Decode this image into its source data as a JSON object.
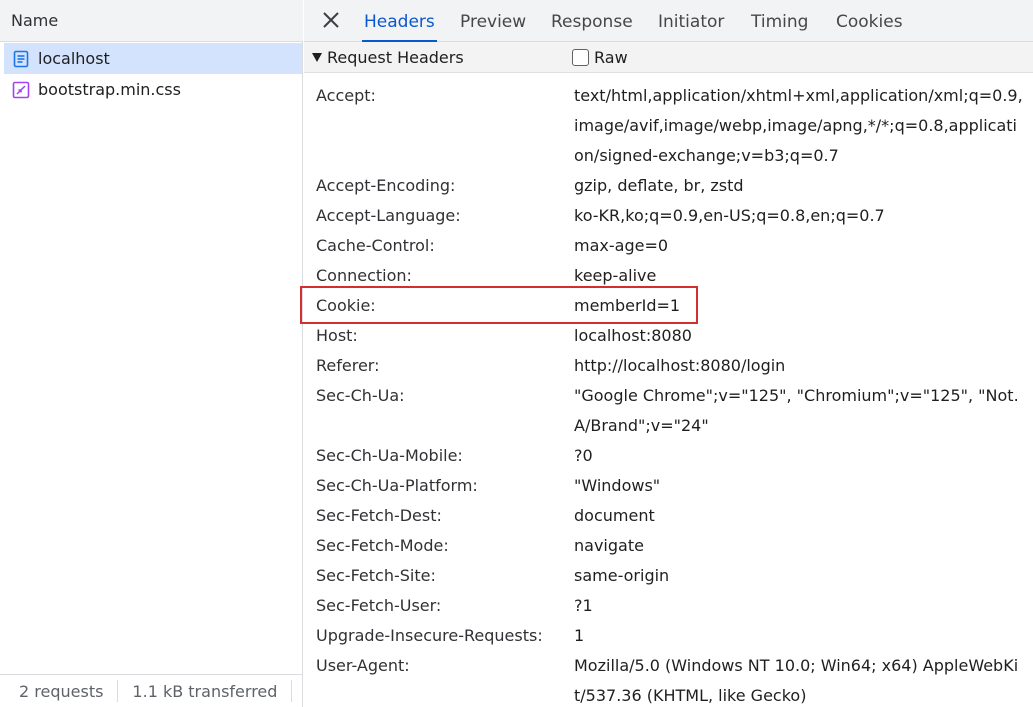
{
  "request_list": {
    "header": "Name",
    "items": [
      {
        "label": "localhost",
        "icon": "document-icon",
        "selected": true
      },
      {
        "label": "bootstrap.min.css",
        "icon": "stylesheet-icon",
        "selected": false
      }
    ],
    "status": {
      "requests": "2 requests",
      "transferred": "1.1 kB transferred"
    }
  },
  "tabs": [
    "Headers",
    "Preview",
    "Response",
    "Initiator",
    "Timing",
    "Cookies"
  ],
  "active_tab": "Headers",
  "section": {
    "title": "Request Headers",
    "raw_label": "Raw",
    "raw_checked": false
  },
  "headers": [
    {
      "name": "Accept:",
      "value": "text/html,application/xhtml+xml,application/xml;q=0.9,image/avif,image/webp,image/apng,*/*;q=0.8,application/signed-exchange;v=b3;q=0.7"
    },
    {
      "name": "Accept-Encoding:",
      "value": "gzip, deflate, br, zstd"
    },
    {
      "name": "Accept-Language:",
      "value": "ko-KR,ko;q=0.9,en-US;q=0.8,en;q=0.7"
    },
    {
      "name": "Cache-Control:",
      "value": "max-age=0"
    },
    {
      "name": "Connection:",
      "value": "keep-alive"
    },
    {
      "name": "Cookie:",
      "value": "memberId=1"
    },
    {
      "name": "Host:",
      "value": "localhost:8080"
    },
    {
      "name": "Referer:",
      "value": "http://localhost:8080/login"
    },
    {
      "name": "Sec-Ch-Ua:",
      "value": "\"Google Chrome\";v=\"125\", \"Chromium\";v=\"125\", \"Not.A/Brand\";v=\"24\""
    },
    {
      "name": "Sec-Ch-Ua-Mobile:",
      "value": "?0"
    },
    {
      "name": "Sec-Ch-Ua-Platform:",
      "value": "\"Windows\""
    },
    {
      "name": "Sec-Fetch-Dest:",
      "value": "document"
    },
    {
      "name": "Sec-Fetch-Mode:",
      "value": "navigate"
    },
    {
      "name": "Sec-Fetch-Site:",
      "value": "same-origin"
    },
    {
      "name": "Sec-Fetch-User:",
      "value": "?1"
    },
    {
      "name": "Upgrade-Insecure-Requests:",
      "value": "1"
    },
    {
      "name": "User-Agent:",
      "value": "Mozilla/5.0 (Windows NT 10.0; Win64; x64) AppleWebKit/537.36 (KHTML, like Gecko)"
    }
  ],
  "highlighted_header": "Cookie:",
  "colors": {
    "accent": "#0b57d0",
    "highlight_border": "#d32f2f",
    "selected_row": "#d3e3fd",
    "css_icon": "#a142f4"
  }
}
